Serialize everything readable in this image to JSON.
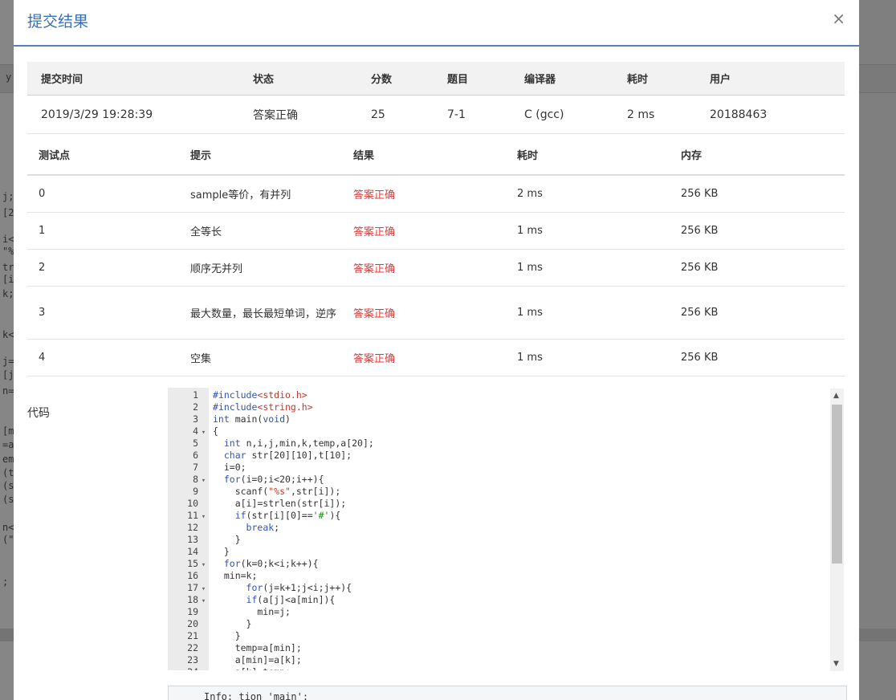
{
  "modal": {
    "title": "提交结果",
    "close": "×"
  },
  "background_snippets": [
    "y",
    "j;",
    "[2",
    "i<",
    "\"%",
    "tr",
    "[i",
    "k;",
    "k<",
    "j=",
    "[j",
    "n=",
    "[m",
    "=a",
    "em",
    "(t",
    "(s",
    "(s",
    "n<",
    "(\"",
    ";"
  ],
  "submission": {
    "headers": [
      "提交时间",
      "状态",
      "分数",
      "题目",
      "编译器",
      "耗时",
      "用户"
    ],
    "row": {
      "time": "2019/3/29 19:28:39",
      "status": "答案正确",
      "score": "25",
      "problem": "7-1",
      "compiler": "C (gcc)",
      "elapsed": "2 ms",
      "user": "20188463"
    },
    "colors": {
      "status": "#e23a3a",
      "problem_link": "#3b6fb6"
    }
  },
  "test_points": {
    "headers": [
      "测试点",
      "提示",
      "结果",
      "耗时",
      "内存"
    ],
    "rows": [
      {
        "id": "0",
        "hint": "sample等价，有并列",
        "result": "答案正确",
        "time": "2 ms",
        "memory": "256 KB"
      },
      {
        "id": "1",
        "hint": "全等长",
        "result": "答案正确",
        "time": "1 ms",
        "memory": "256 KB"
      },
      {
        "id": "2",
        "hint": "顺序无并列",
        "result": "答案正确",
        "time": "1 ms",
        "memory": "256 KB"
      },
      {
        "id": "3",
        "hint": "最大数量，最长最短单词，逆序",
        "result": "答案正确",
        "time": "1 ms",
        "memory": "256 KB"
      },
      {
        "id": "4",
        "hint": "空集",
        "result": "答案正确",
        "time": "1 ms",
        "memory": "256 KB"
      }
    ]
  },
  "code": {
    "label": "代码",
    "lines": [
      "#include<stdio.h>",
      "#include<string.h>",
      "int main(void)",
      "{",
      "  int n,i,j,min,k,temp,a[20];",
      "  char str[20][10],t[10];",
      "  i=0;",
      "  for(i=0;i<20;i++){",
      "    scanf(\"%s\",str[i]);",
      "    a[i]=strlen(str[i]);",
      "    if(str[i][0]=='#'){",
      "      break;",
      "    }",
      "  }",
      "  for(k=0;k<i;k++){",
      "  min=k;",
      "      for(j=k+1;j<i;j++){",
      "      if(a[j]<a[min]){",
      "        min=j;",
      "      }",
      "    }",
      "    temp=a[min];",
      "    a[min]=a[k];",
      "    a[k]=temp;"
    ],
    "fold_lines": [
      4,
      8,
      11,
      15,
      17,
      18
    ]
  },
  "compile_output": "Info: tion 'main':"
}
